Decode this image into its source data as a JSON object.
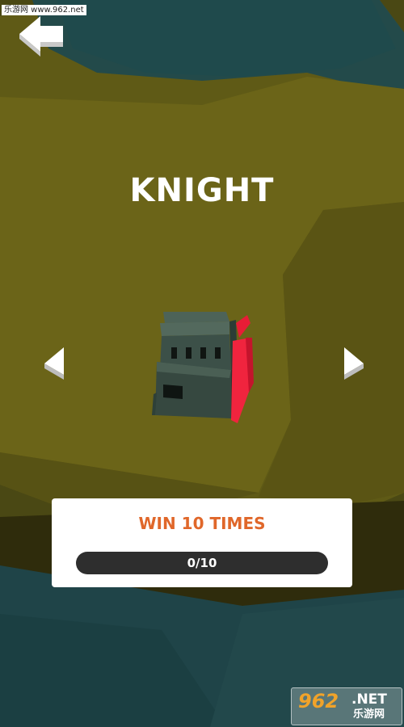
{
  "watermark": {
    "text": "乐游网 www.962.net"
  },
  "screen": {
    "back_icon": "back-arrow-icon",
    "character_name": "KNIGHT",
    "prev_icon": "chevron-left-icon",
    "next_icon": "chevron-right-icon"
  },
  "unlock_task": {
    "title": "WIN 10 TIMES",
    "progress_text": "0/10",
    "progress_current": 0,
    "progress_total": 10,
    "progress_fraction": 0
  },
  "logo": {
    "number": "962",
    "tld": ".NET",
    "name": "乐游网"
  },
  "colors": {
    "accent_orange": "#e0672a",
    "ground_olive": "#5f5a16",
    "water_teal": "#1f4a4c",
    "helmet_green": "#3c5048",
    "plume_red": "#f0243e",
    "card_white": "#ffffff",
    "progress_track": "#2e2e2e"
  }
}
